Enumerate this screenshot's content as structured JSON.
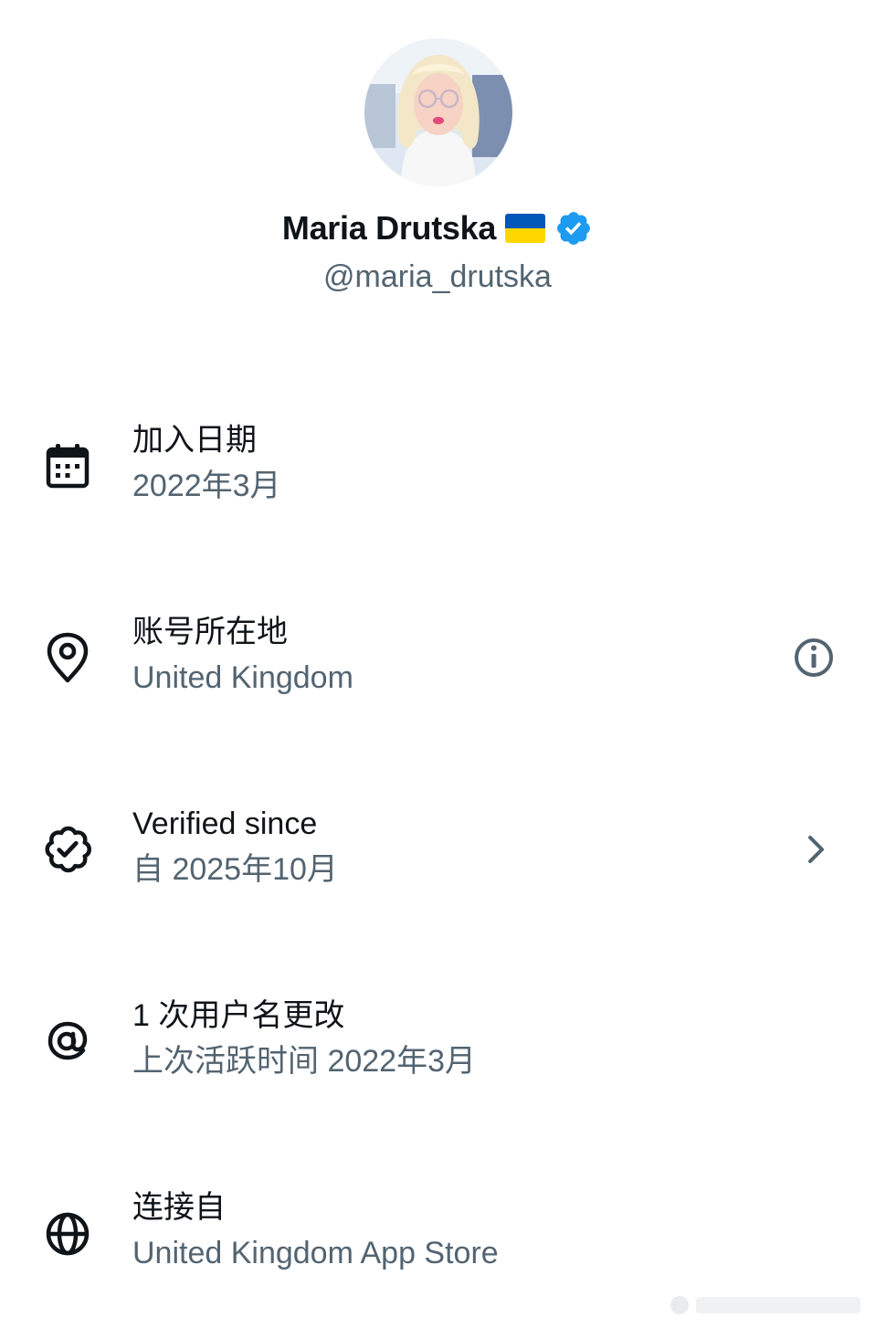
{
  "profile": {
    "display_name": "Maria Drutska",
    "flag_icon": "ukraine-flag-icon",
    "verified_icon": "verified-badge-icon",
    "handle": "@maria_drutska"
  },
  "colors": {
    "text_primary": "#0f1419",
    "text_secondary": "#536471",
    "verified_blue": "#1d9bf0",
    "flag_blue": "#0057b7",
    "flag_yellow": "#ffd700"
  },
  "rows": [
    {
      "icon": "calendar-icon",
      "title": "加入日期",
      "subtitle": "2022年3月"
    },
    {
      "icon": "location-pin-icon",
      "title": "账号所在地",
      "subtitle": "United Kingdom",
      "action_icon": "info-icon"
    },
    {
      "icon": "verified-outline-icon",
      "title": "Verified since",
      "subtitle": "自 2025年10月",
      "action_icon": "chevron-right-icon"
    },
    {
      "icon": "at-sign-icon",
      "title": "1 次用户名更改",
      "subtitle": "上次活跃时间 2022年3月"
    },
    {
      "icon": "globe-icon",
      "title": "连接自",
      "subtitle": "United Kingdom App Store"
    }
  ]
}
